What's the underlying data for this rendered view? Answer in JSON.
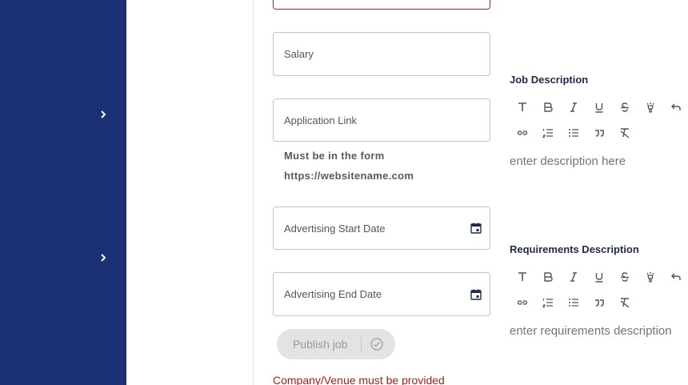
{
  "form": {
    "salary_placeholder": "Salary",
    "application_link_placeholder": "Application Link",
    "application_link_hint_line1": "Must be in the form",
    "application_link_hint_line2": "https://websitename.com",
    "start_date_placeholder": "Advertising Start Date",
    "end_date_placeholder": "Advertising End Date",
    "publish_label": "Publish job",
    "error_message": "Company/Venue must be provided"
  },
  "job_description": {
    "title": "Job Description",
    "placeholder": "enter description here"
  },
  "requirements_description": {
    "title": "Requirements Description",
    "placeholder": "enter requirements description"
  },
  "colors": {
    "sidebar": "#1a3175",
    "error": "#a3221a",
    "disabled_button": "#e3e3e3"
  },
  "toolbar_icons": [
    "text-icon",
    "bold-icon",
    "italic-icon",
    "underline-icon",
    "strikethrough-icon",
    "highlight-icon",
    "undo-icon",
    "link-icon",
    "ordered-list-icon",
    "bullet-list-icon",
    "quote-icon",
    "clear-format-icon"
  ]
}
